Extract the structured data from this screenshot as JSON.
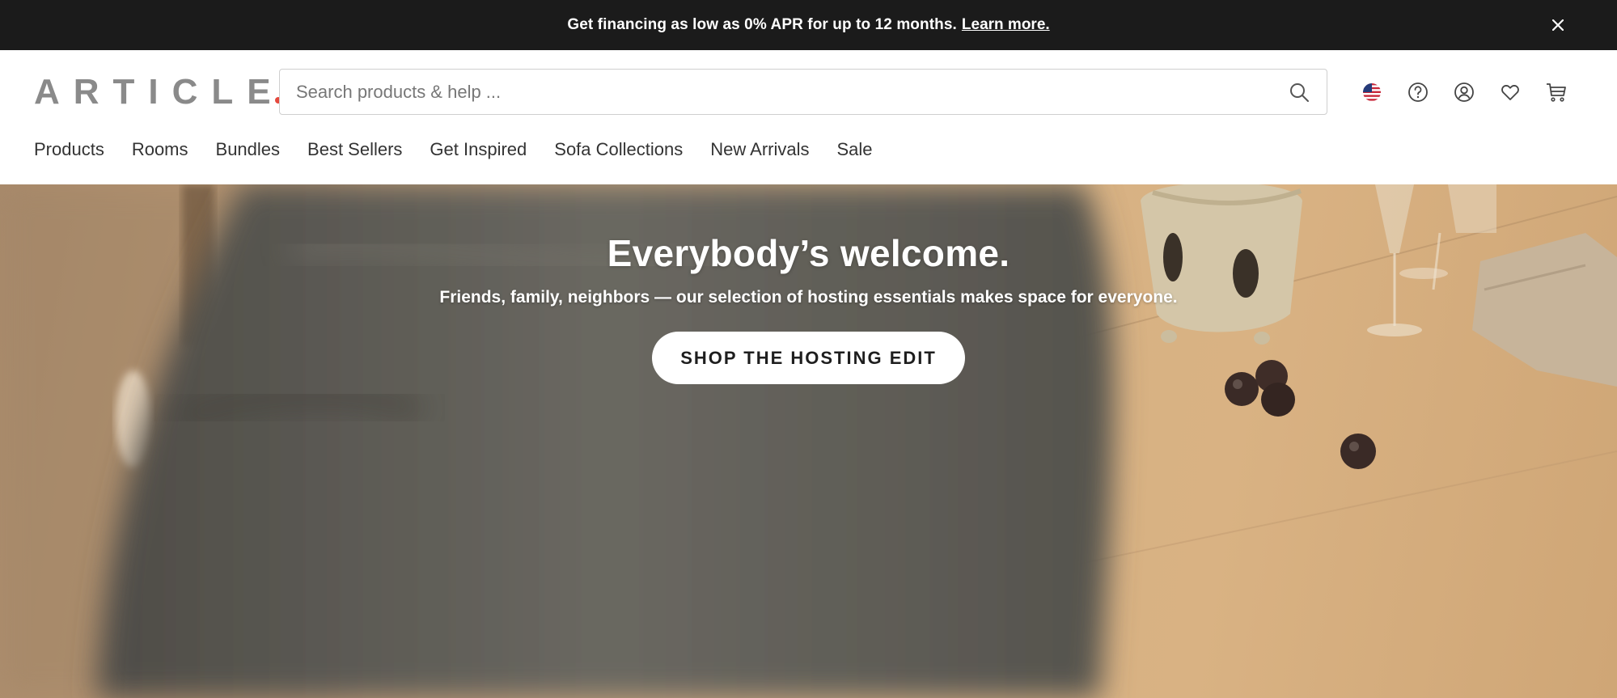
{
  "promo": {
    "text": "Get financing as low as 0% APR for up to 12 months.",
    "link": "Learn more.",
    "close_icon": "close-icon"
  },
  "header": {
    "logo": "ARTICLE",
    "logo_accent_color": "#e5483d",
    "search": {
      "placeholder": "Search products & help ...",
      "value": "",
      "icon": "search-icon"
    },
    "icons": [
      "us-flag-icon",
      "help-icon",
      "account-icon",
      "heart-icon",
      "cart-icon"
    ]
  },
  "nav": {
    "items": [
      {
        "label": "Products"
      },
      {
        "label": "Rooms"
      },
      {
        "label": "Bundles"
      },
      {
        "label": "Best Sellers"
      },
      {
        "label": "Get Inspired"
      },
      {
        "label": "Sofa Collections"
      },
      {
        "label": "New Arrivals"
      },
      {
        "label": "Sale"
      }
    ]
  },
  "hero": {
    "title": "Everybody’s welcome.",
    "subtitle": "Friends, family, neighbors — our selection of hosting essentials makes space for everyone.",
    "cta": "SHOP THE HOSTING EDIT"
  }
}
